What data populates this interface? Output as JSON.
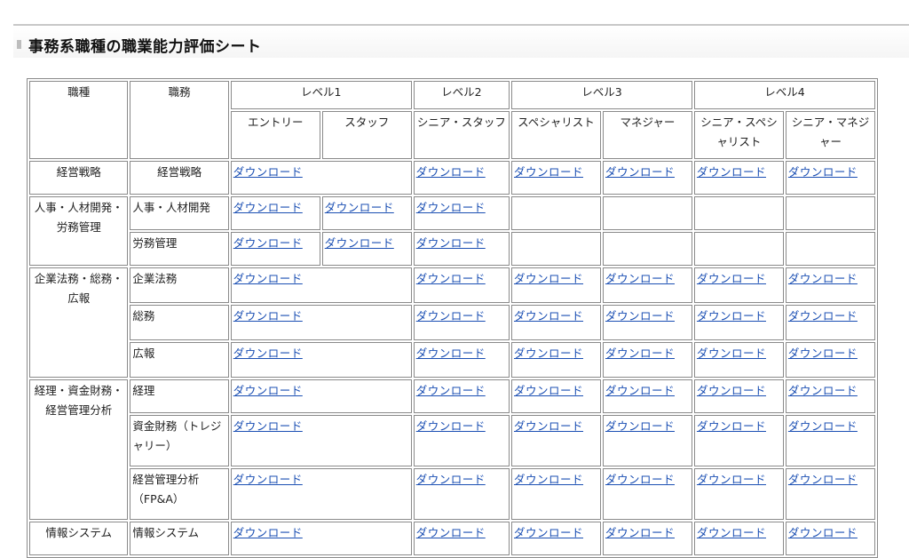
{
  "page_title": "事務系職種の職業能力評価シート",
  "header": {
    "col_shokushu": "職種",
    "col_shokumu": "職務",
    "levels": [
      "レベル1",
      "レベル2",
      "レベル3",
      "レベル4"
    ],
    "sub": [
      "エントリー",
      "スタッフ",
      "シニア・スタッフ",
      "スペシャリスト",
      "マネジャー",
      "シニア・スペシャリスト",
      "シニア・マネジャー"
    ]
  },
  "link_text": "ダウンロード",
  "categories": {
    "keiei_senryaku": "経営戦略",
    "jinji": "人事・人材開発・労務管理",
    "kigyo": "企業法務・総務・広報",
    "keiri": "経理・資金財務・経営管理分析",
    "joho": "情報システム"
  },
  "duties": {
    "keiei_senryaku": "経営戦略",
    "jinji_kaihatsu": "人事・人材開発",
    "romu": "労務管理",
    "kigyo_homu": "企業法務",
    "somu": "総務",
    "koho": "広報",
    "keiri": "経理",
    "shikin": "資金財務（トレジャリー）",
    "keiei_bunseki": "経営管理分析（FP&A）",
    "joho": "情報システム"
  }
}
